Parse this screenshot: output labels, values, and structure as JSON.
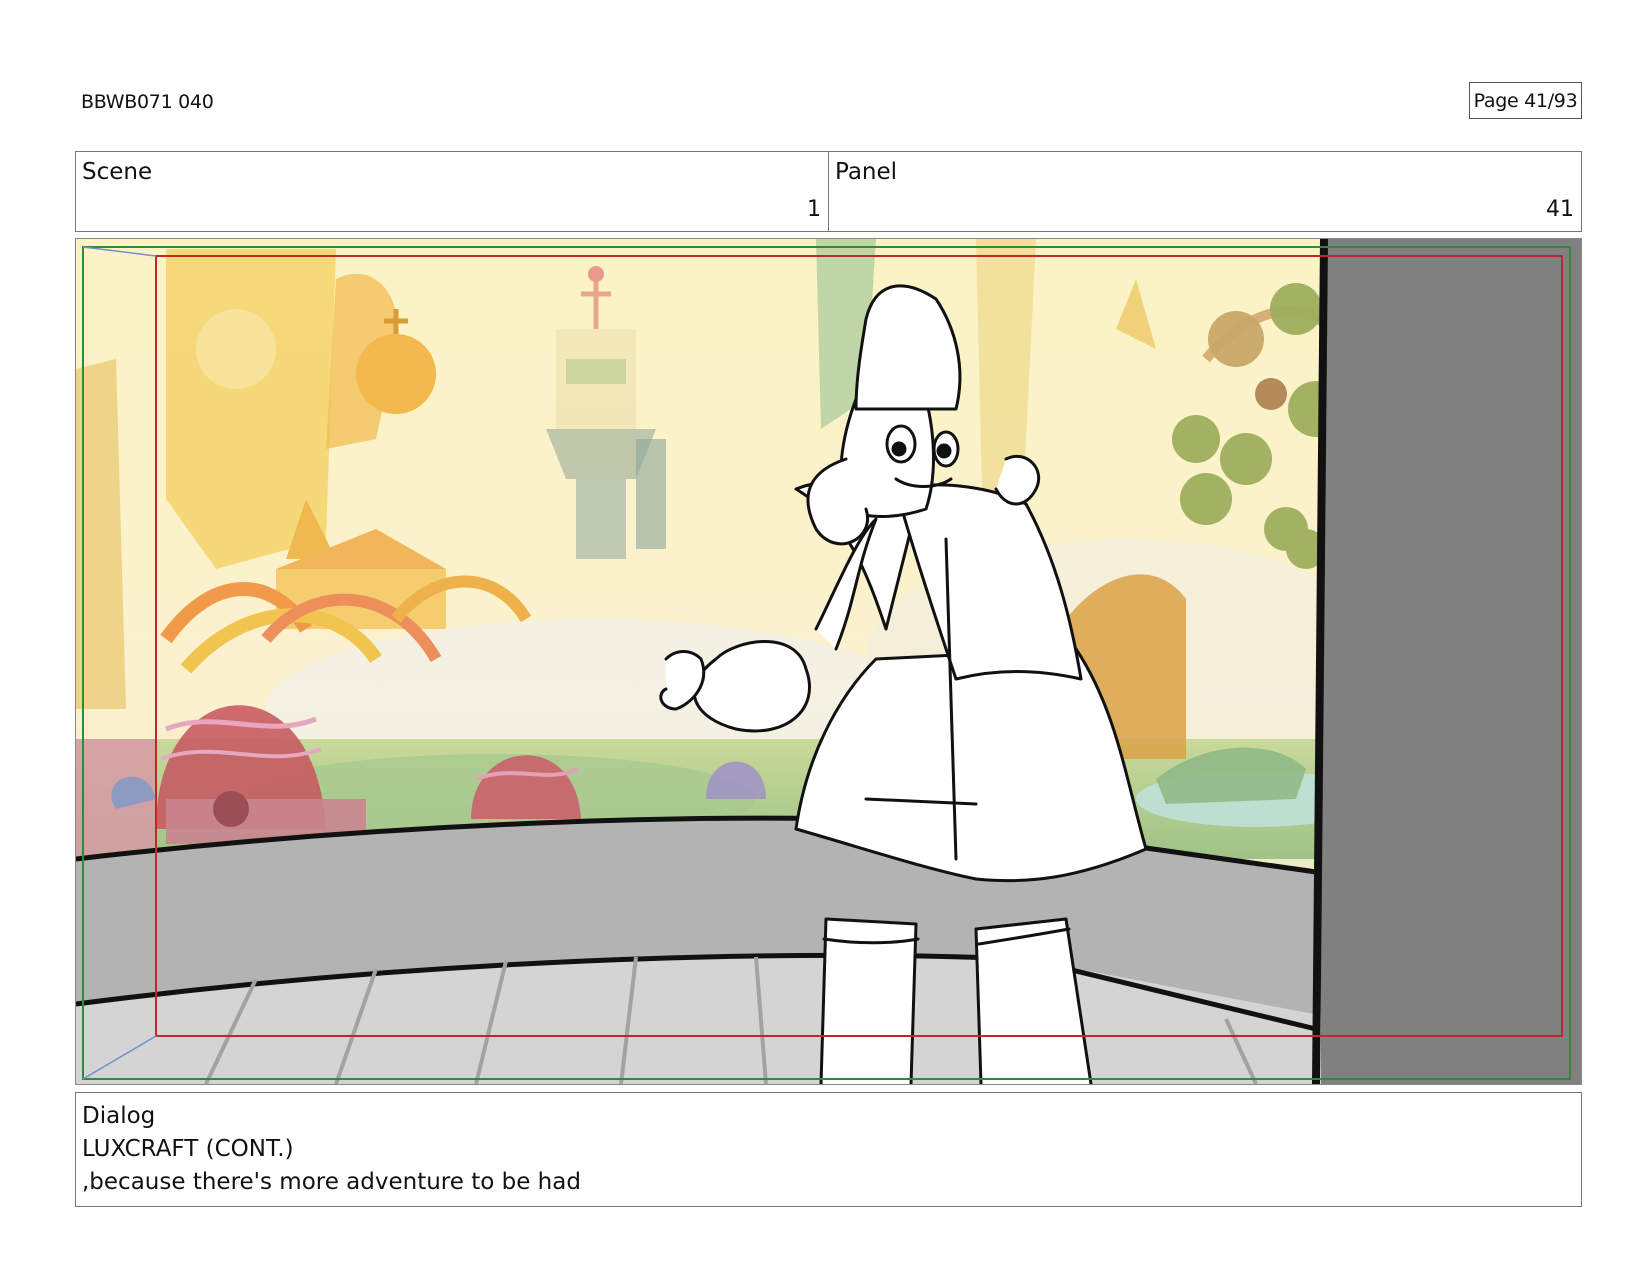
{
  "document": {
    "id": "BBWB071 040",
    "page": "Page 41/93"
  },
  "header": {
    "scene_label": "Scene",
    "scene_value": "1",
    "panel_label": "Panel",
    "panel_value": "41"
  },
  "dialog": {
    "label": "Dialog",
    "character": "LUXCRAFT (CONT.)",
    "line": ",because there's more adventure to be had"
  },
  "colors": {
    "safe_frame_red": "#c0272d",
    "action_frame_green": "#2e8b3a",
    "wall_gray": "#b3b3b3",
    "door_gray": "#7f7f7f"
  }
}
